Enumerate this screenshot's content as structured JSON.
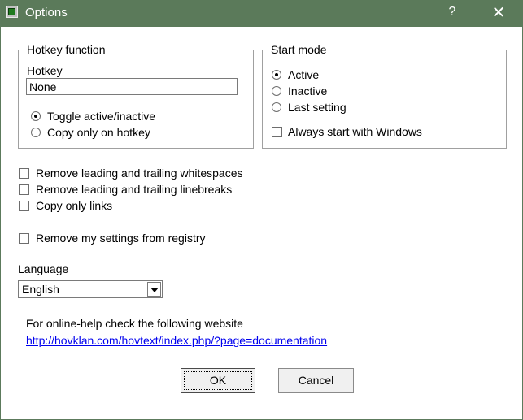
{
  "window": {
    "title": "Options",
    "help_symbol": "?",
    "close_symbol": "✕"
  },
  "hotkey_group": {
    "title": "Hotkey function",
    "hotkey_label": "Hotkey",
    "hotkey_value": "None",
    "options": [
      {
        "label": "Toggle active/inactive",
        "checked": true
      },
      {
        "label": "Copy only on hotkey",
        "checked": false
      }
    ]
  },
  "start_group": {
    "title": "Start mode",
    "options": [
      {
        "label": "Active",
        "checked": true
      },
      {
        "label": "Inactive",
        "checked": false
      },
      {
        "label": "Last setting",
        "checked": false
      }
    ],
    "always_start": {
      "label": "Always start with Windows",
      "checked": false
    }
  },
  "checkboxes": [
    {
      "label": "Remove leading and trailing whitespaces",
      "checked": false
    },
    {
      "label": "Remove leading and trailing linebreaks",
      "checked": false
    },
    {
      "label": "Copy only links",
      "checked": false
    },
    {
      "label": "Remove my settings from registry",
      "checked": false
    }
  ],
  "language": {
    "label": "Language",
    "selected": "English"
  },
  "help": {
    "text": "For online-help check the following website",
    "url": "http://hovklan.com/hovtext/index.php/?page=documentation"
  },
  "buttons": {
    "ok": "OK",
    "cancel": "Cancel"
  }
}
